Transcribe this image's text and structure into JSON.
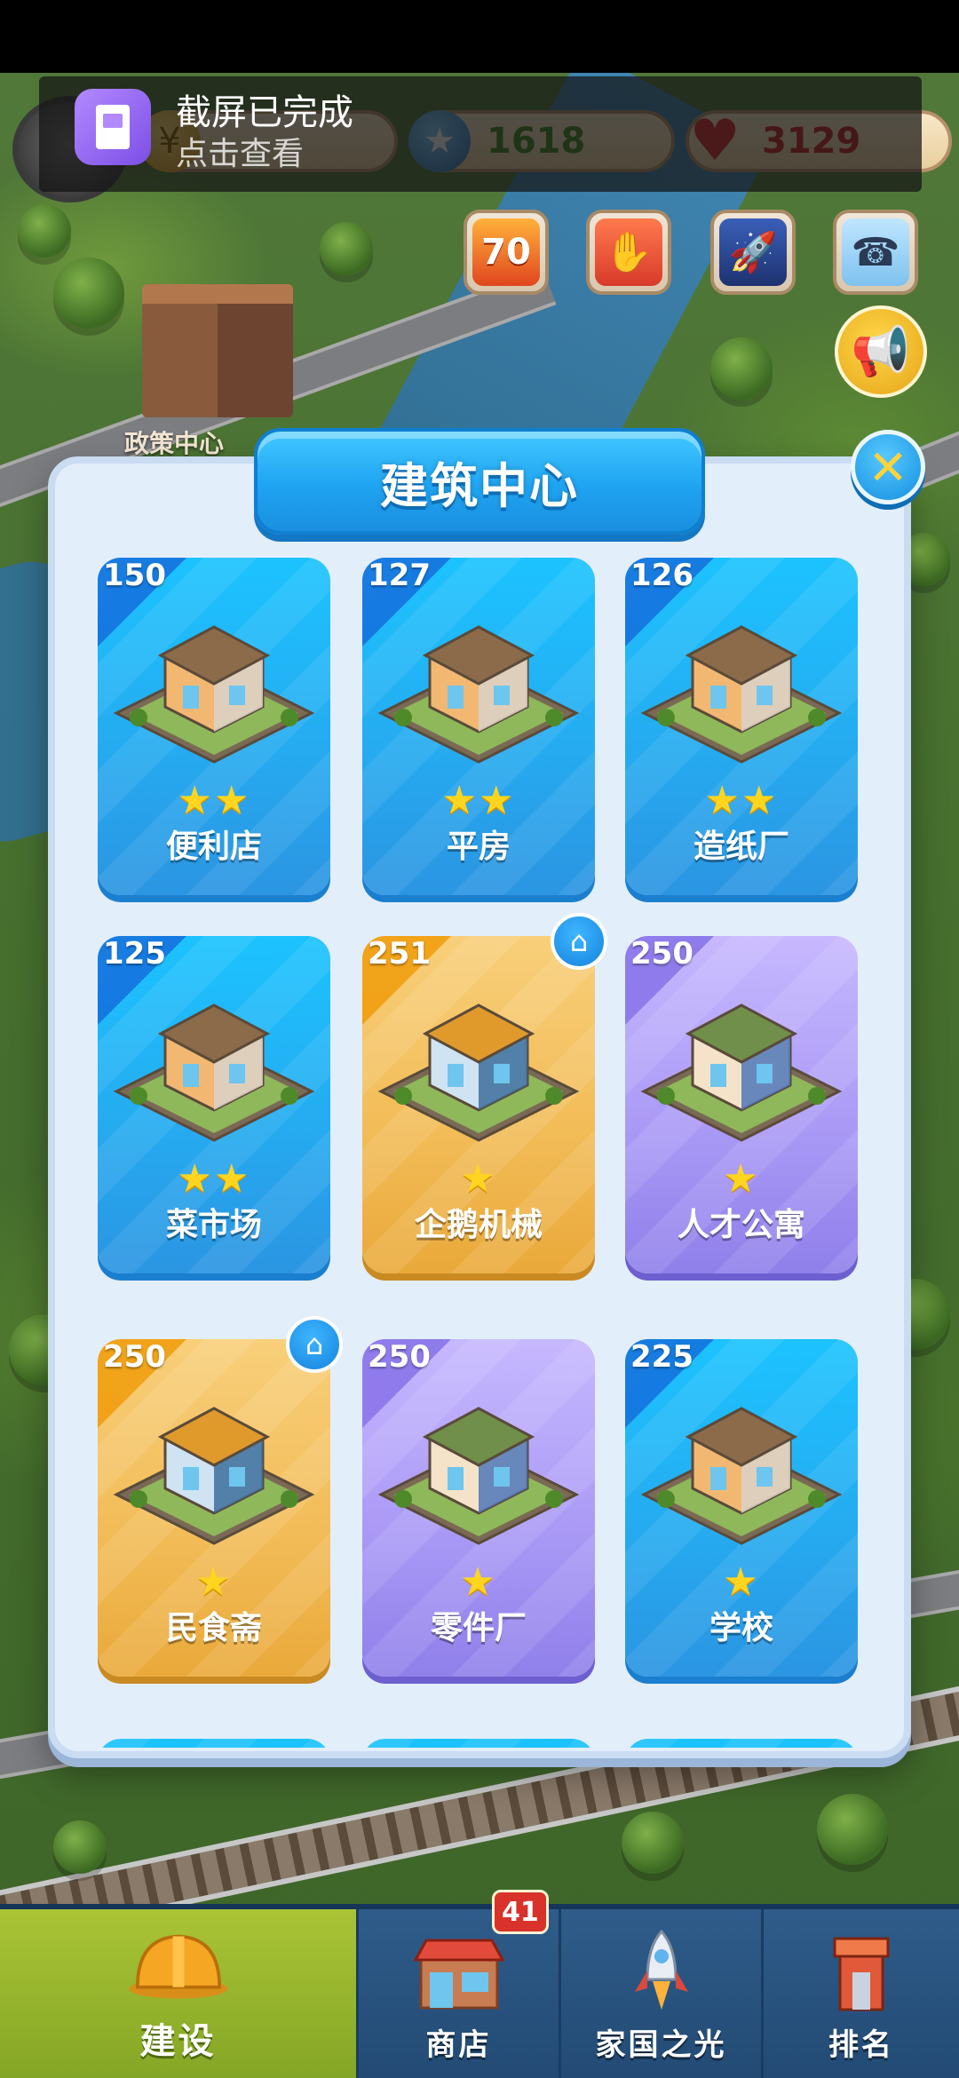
{
  "notification": {
    "title": "截屏已完成",
    "subtitle": "点击查看"
  },
  "hud": {
    "coins": "",
    "stars": "1618",
    "hearts": "3129"
  },
  "background": {
    "building_label": "政策中心"
  },
  "activity_buttons": [
    {
      "name": "event-70-icon",
      "label": "70"
    },
    {
      "name": "handshake-icon",
      "label": ""
    },
    {
      "name": "rocket-icon",
      "label": ""
    },
    {
      "name": "customer-service-icon",
      "label": ""
    }
  ],
  "modal": {
    "title": "建筑中心",
    "close_label": "✕"
  },
  "buildings": [
    {
      "count": "150",
      "name": "便利店",
      "stars": 2,
      "color": "blue",
      "home": false
    },
    {
      "count": "127",
      "name": "平房",
      "stars": 2,
      "color": "blue",
      "home": false
    },
    {
      "count": "126",
      "name": "造纸厂",
      "stars": 2,
      "color": "blue",
      "home": false
    },
    {
      "count": "125",
      "name": "菜市场",
      "stars": 2,
      "color": "blue",
      "home": false
    },
    {
      "count": "251",
      "name": "企鹅机械",
      "stars": 1,
      "color": "orange",
      "home": true
    },
    {
      "count": "250",
      "name": "人才公寓",
      "stars": 1,
      "color": "purple",
      "home": false
    },
    {
      "count": "250",
      "name": "民食斋",
      "stars": 1,
      "color": "orange",
      "home": true
    },
    {
      "count": "250",
      "name": "零件厂",
      "stars": 1,
      "color": "purple",
      "home": false
    },
    {
      "count": "225",
      "name": "学校",
      "stars": 1,
      "color": "blue",
      "home": false
    }
  ],
  "bottom_nav": {
    "items": [
      {
        "label": "建设",
        "active": true
      },
      {
        "label": "商店",
        "active": false
      },
      {
        "label": "家国之光",
        "active": false
      },
      {
        "label": "排名",
        "active": false
      }
    ],
    "shop_badge": "41"
  },
  "colors": {
    "card_blue": "#26a9ef",
    "card_orange": "#f2bb56",
    "card_purple": "#a898f5",
    "title_blue": "#1fa4f2",
    "nav_active": "#aac435"
  }
}
